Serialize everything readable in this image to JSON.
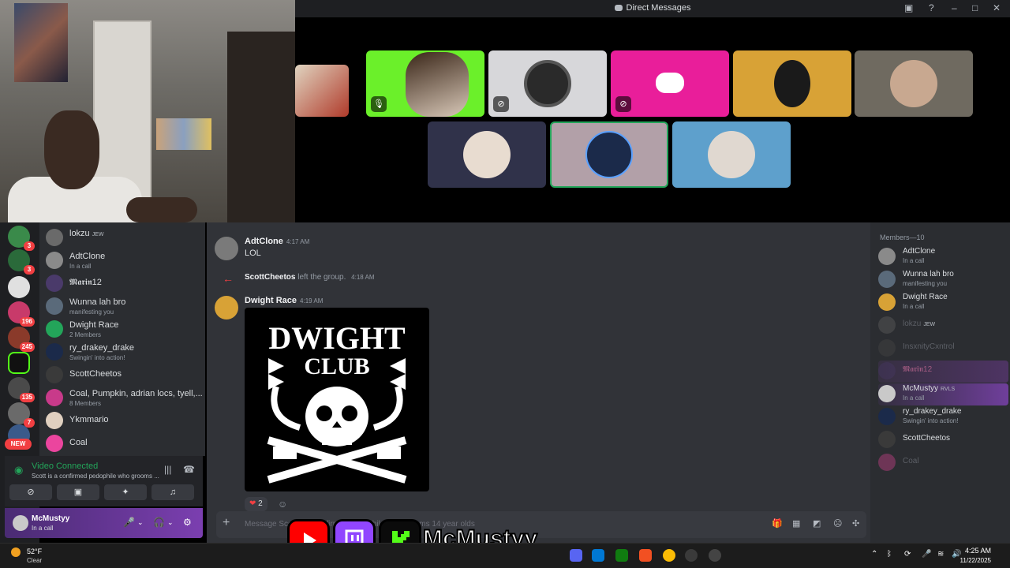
{
  "window": {
    "title": "Direct Messages"
  },
  "dm_list": [
    {
      "name": "lokzu",
      "tag": "JEW",
      "status": ""
    },
    {
      "name": "AdtClone",
      "status": "In a call"
    },
    {
      "name": "𝕸𝖆𝖗𝖎𝖓12",
      "status": ""
    },
    {
      "name": "Wunna lah bro",
      "status": "manifesting you"
    },
    {
      "name": "Dwight Race",
      "status": "2 Members"
    },
    {
      "name": "ry_drakey_drake",
      "status": "Swingin' into action!"
    },
    {
      "name": "ScottCheetos",
      "status": ""
    },
    {
      "name": "Coal, Pumpkin, adrian locs, tyell,...",
      "status": "8 Members"
    },
    {
      "name": "Ykmmario",
      "status": ""
    },
    {
      "name": "Coal",
      "status": ""
    }
  ],
  "guild_badges": [
    "3",
    "3",
    "196",
    "245",
    "135",
    "7"
  ],
  "guild_new": "NEW",
  "voice": {
    "status": "Video Connected",
    "channel": "Scott is a confirmed pedophile who grooms ..."
  },
  "user": {
    "name": "McMustyy",
    "status": "In a call"
  },
  "messages": [
    {
      "author": "AdtClone",
      "time": "4:17 AM",
      "text": "LOL"
    },
    {
      "author": "Dwight Race",
      "time": "4:19 AM",
      "text": ""
    }
  ],
  "system_message": {
    "who": "ScottCheetos",
    "text": "left the group.",
    "time": "4:18 AM"
  },
  "embed_image": {
    "line1": "DWIGHT",
    "line2": "CLUB"
  },
  "reaction": {
    "emoji": "❤",
    "count": "2"
  },
  "composer": {
    "placeholder": "Message Scott is a confirmed pedophile who grooms 14 year olds"
  },
  "members": {
    "header": "Members—10",
    "list": [
      {
        "name": "AdtClone",
        "status": "In a call",
        "offline": false
      },
      {
        "name": "Wunna lah bro",
        "status": "manifesting you",
        "offline": false
      },
      {
        "name": "Dwight Race",
        "status": "In a call",
        "offline": false
      },
      {
        "name": "lokzu",
        "tag": "JEW",
        "status": "",
        "offline": true
      },
      {
        "name": "InsxnityCxntrol",
        "status": "",
        "offline": true
      },
      {
        "name": "𝕸𝖆𝖗𝖎𝖓12",
        "status": "",
        "offline": true
      },
      {
        "name": "McMustyy",
        "tag": "RVLS",
        "status": "In a call",
        "offline": false
      },
      {
        "name": "ry_drakey_drake",
        "status": "Swingin' into action!",
        "offline": false
      },
      {
        "name": "ScottCheetos",
        "status": "",
        "offline": false
      },
      {
        "name": "Coal",
        "status": "",
        "offline": true
      }
    ]
  },
  "streamer_name": "McMustyy",
  "taskbar": {
    "temp": "52°F",
    "condition": "Clear",
    "time": "4:25 AM",
    "date": "11/22/2025"
  },
  "colors": {
    "accent": "#5865f2",
    "online": "#23a55a",
    "danger": "#f23f42"
  }
}
